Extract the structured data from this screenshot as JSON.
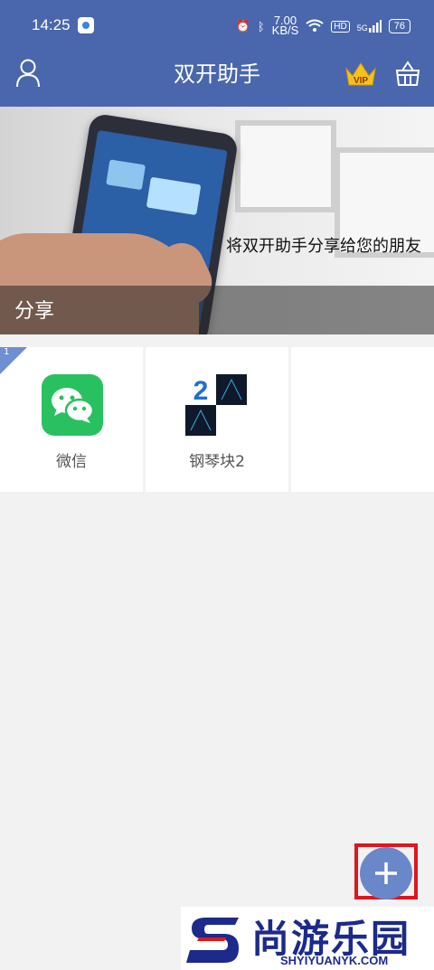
{
  "status_bar": {
    "time": "14:25",
    "net_speed_value": "7.00",
    "net_speed_unit": "KB/S",
    "hd": "HD",
    "network": "5G",
    "battery": "76"
  },
  "app_bar": {
    "title": "双开助手",
    "vip_label": "VIP"
  },
  "banner": {
    "text": "将双开助手分享给您的朋友",
    "share_label": "分享"
  },
  "apps": [
    {
      "name": "微信",
      "icon": "wechat-icon",
      "badge": "1"
    },
    {
      "name": "钢琴块2",
      "icon": "piano-tiles-2-icon"
    }
  ],
  "watermark": {
    "cn": "尚游乐园",
    "en": "SHYIYUANYK.COM"
  },
  "colors": {
    "header": "#4a67ad",
    "fab": "#6a87c9",
    "highlight_frame": "#e0161c",
    "wechat": "#29c15f"
  }
}
